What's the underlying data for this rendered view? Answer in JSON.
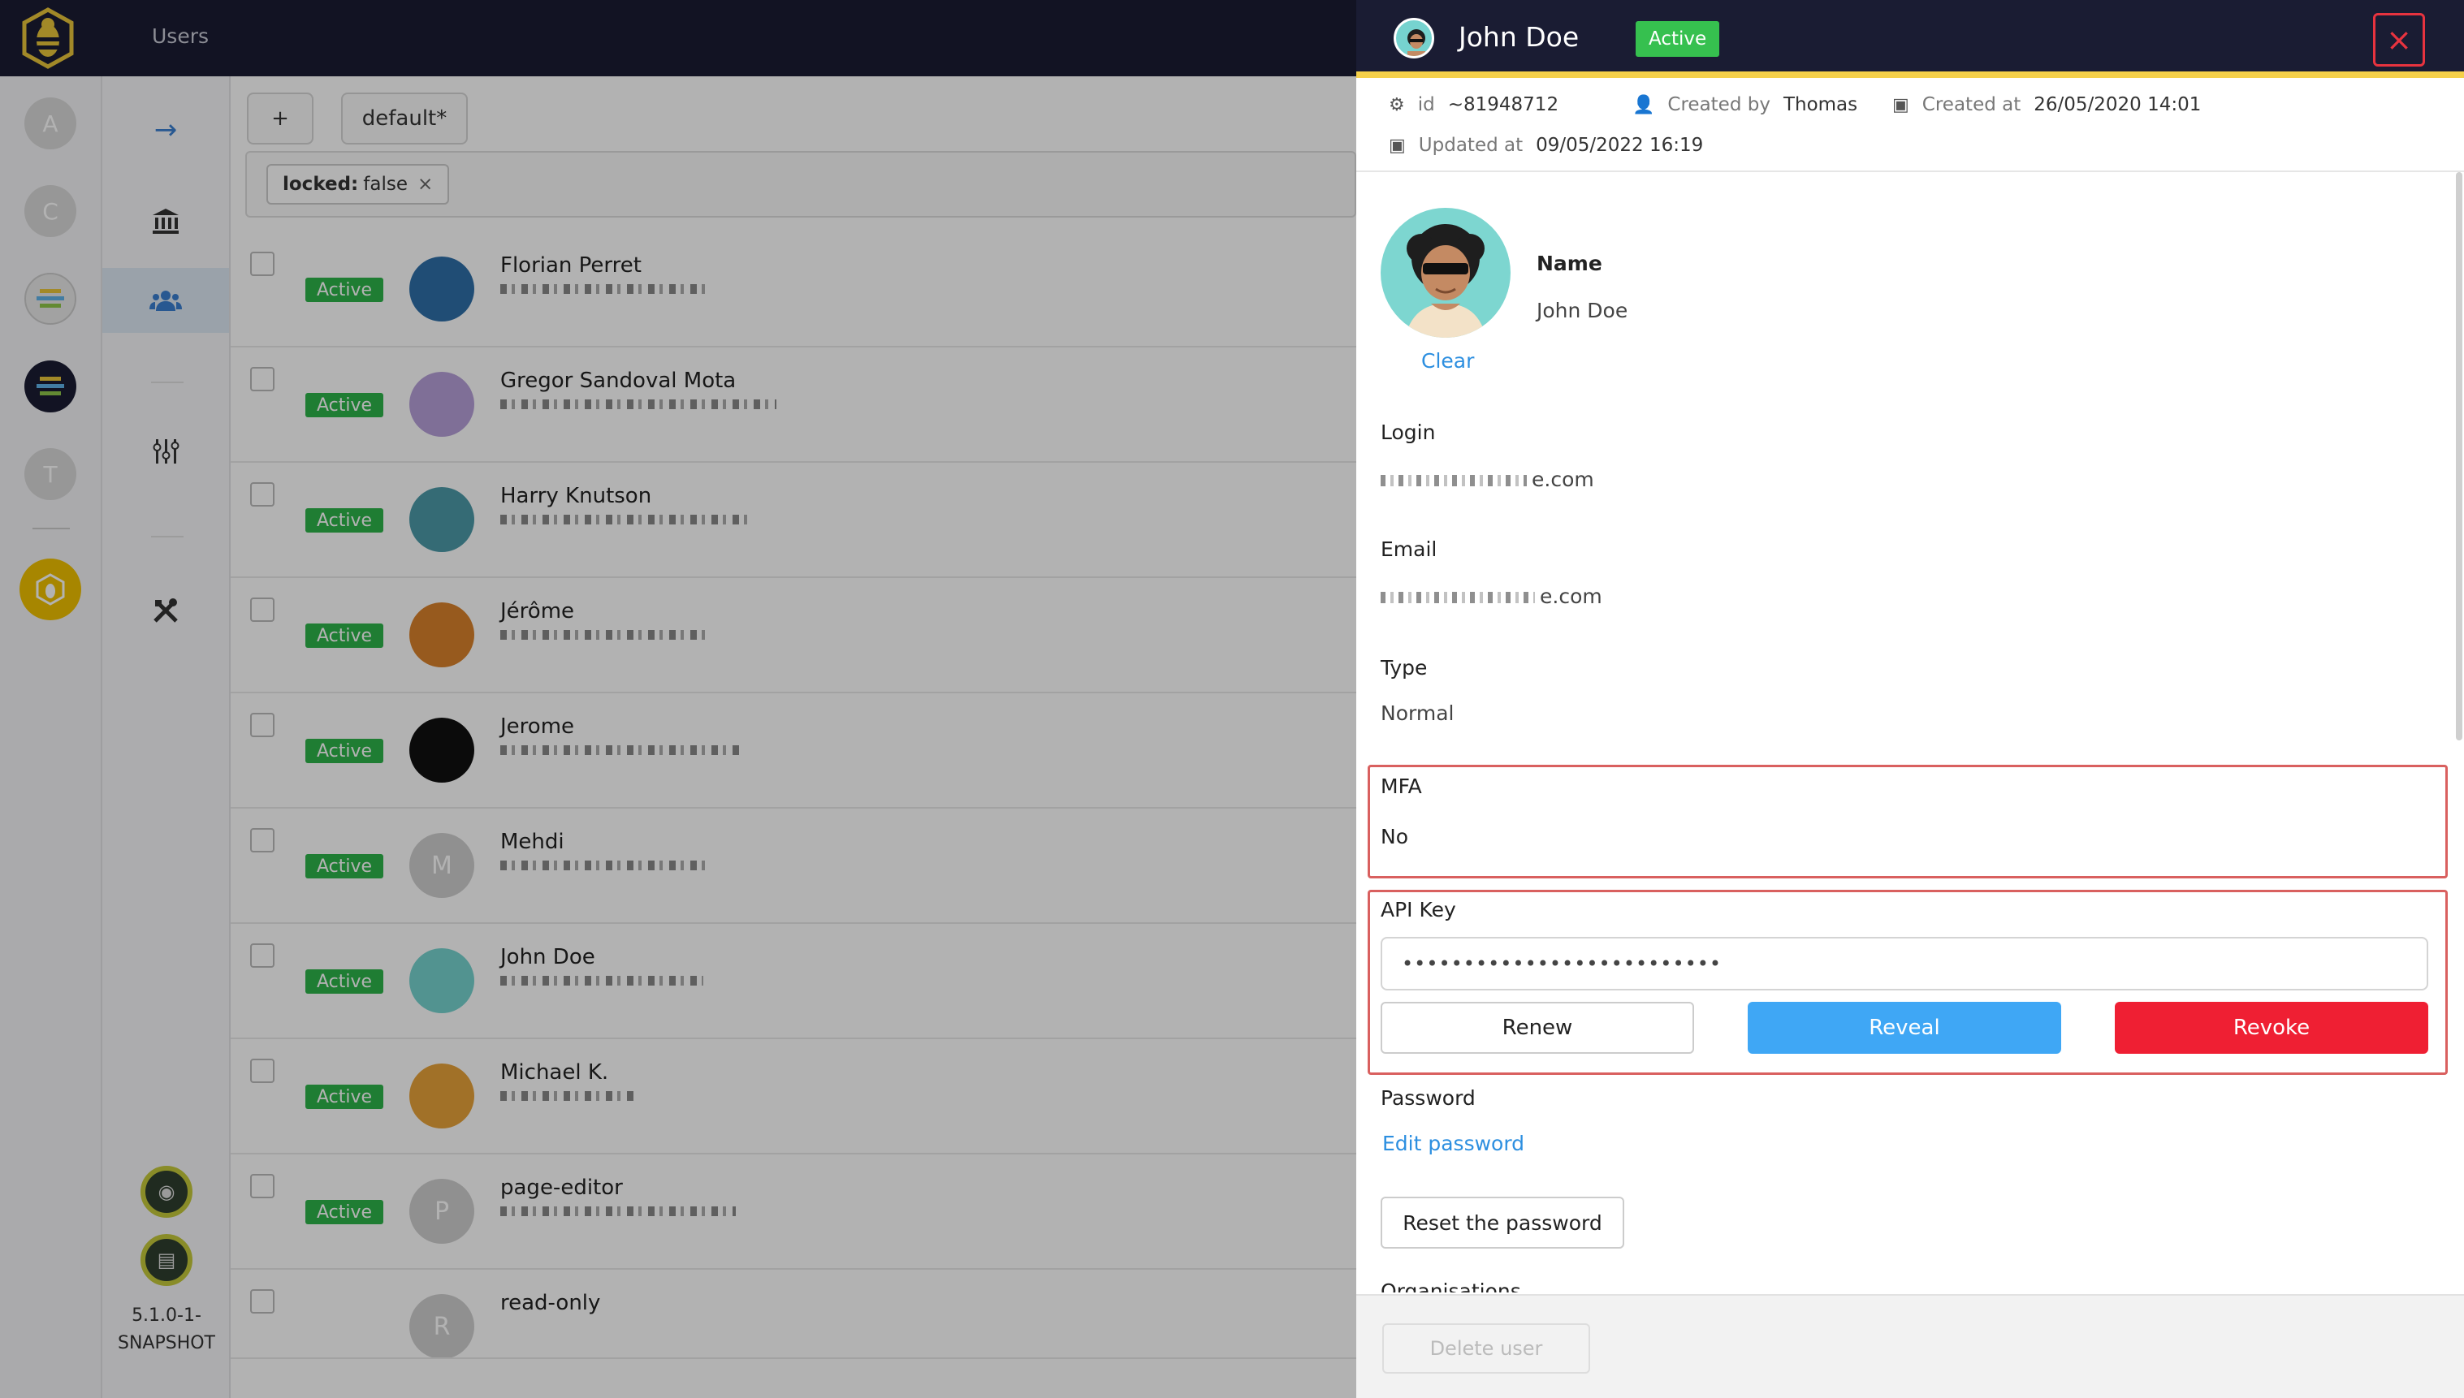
{
  "app": {
    "page_title": "Users",
    "version": "5.1.0-1-SNAPSHOT",
    "rail_items": [
      {
        "letter": "A",
        "color": "#d8d8d8"
      },
      {
        "letter": "C",
        "color": "#d8d8d8"
      },
      {
        "letter": "",
        "color": "#e8e8e8"
      },
      {
        "letter": "",
        "color": "#1a1c33"
      },
      {
        "letter": "T",
        "color": "#d8d8d8"
      },
      {
        "letter": "",
        "color": "#f0c000"
      }
    ],
    "nav_icons": [
      "arrow-right-icon",
      "bank-icon",
      "users-icon",
      "sliders-icon",
      "tools-icon"
    ],
    "toolbar": {
      "add_label": "+",
      "preset_label": "default*"
    },
    "filter": {
      "key": "locked:",
      "value": "false",
      "remove": "×"
    }
  },
  "users": [
    {
      "status": "Active",
      "name": "Florian Perret",
      "avatar_color": "#2f6fa8",
      "initial": ""
    },
    {
      "status": "Active",
      "name": "Gregor Sandoval Mota",
      "avatar_color": "#b6a0d8",
      "initial": ""
    },
    {
      "status": "Active",
      "name": "Harry Knutson",
      "avatar_color": "#4c9aa8",
      "initial": ""
    },
    {
      "status": "Active",
      "name": "Jérôme",
      "avatar_color": "#d9822b",
      "initial": ""
    },
    {
      "status": "Active",
      "name": "Jerome",
      "avatar_color": "#111111",
      "initial": ""
    },
    {
      "status": "Active",
      "name": "Mehdi",
      "avatar_color": "#cfcfcf",
      "initial": "M"
    },
    {
      "status": "Active",
      "name": "John Doe",
      "avatar_color": "#76d3cf",
      "initial": ""
    },
    {
      "status": "Active",
      "name": "Michael K.",
      "avatar_color": "#e7a23a",
      "initial": ""
    },
    {
      "status": "Active",
      "name": "page-editor",
      "avatar_color": "#cfcfcf",
      "initial": "P"
    },
    {
      "status": "",
      "name": "read-only",
      "avatar_color": "#cfcfcf",
      "initial": "R"
    }
  ],
  "drawer": {
    "title": "John Doe",
    "status": "Active",
    "close": "×",
    "meta": {
      "id_label": "id",
      "id_value": "~81948712",
      "created_by_label": "Created by",
      "created_by_value": "Thomas",
      "created_at_label": "Created at",
      "created_at_value": "26/05/2020 14:01",
      "updated_at_label": "Updated at",
      "updated_at_value": "09/05/2022 16:19"
    },
    "clear_label": "Clear",
    "name_label": "Name",
    "name_value": "John Doe",
    "login_label": "Login",
    "login_suffix": "e.com",
    "email_label": "Email",
    "email_suffix": "e.com",
    "type_label": "Type",
    "type_value": "Normal",
    "mfa_label": "MFA",
    "mfa_value": "No",
    "api_key_label": "API Key",
    "api_key_value": "••••••••••••••••••••••••••",
    "renew_label": "Renew",
    "reveal_label": "Reveal",
    "revoke_label": "Revoke",
    "password_label": "Password",
    "edit_password_label": "Edit password",
    "reset_password_label": "Reset the password",
    "organisations_label": "Organisations",
    "delete_label": "Delete user"
  }
}
